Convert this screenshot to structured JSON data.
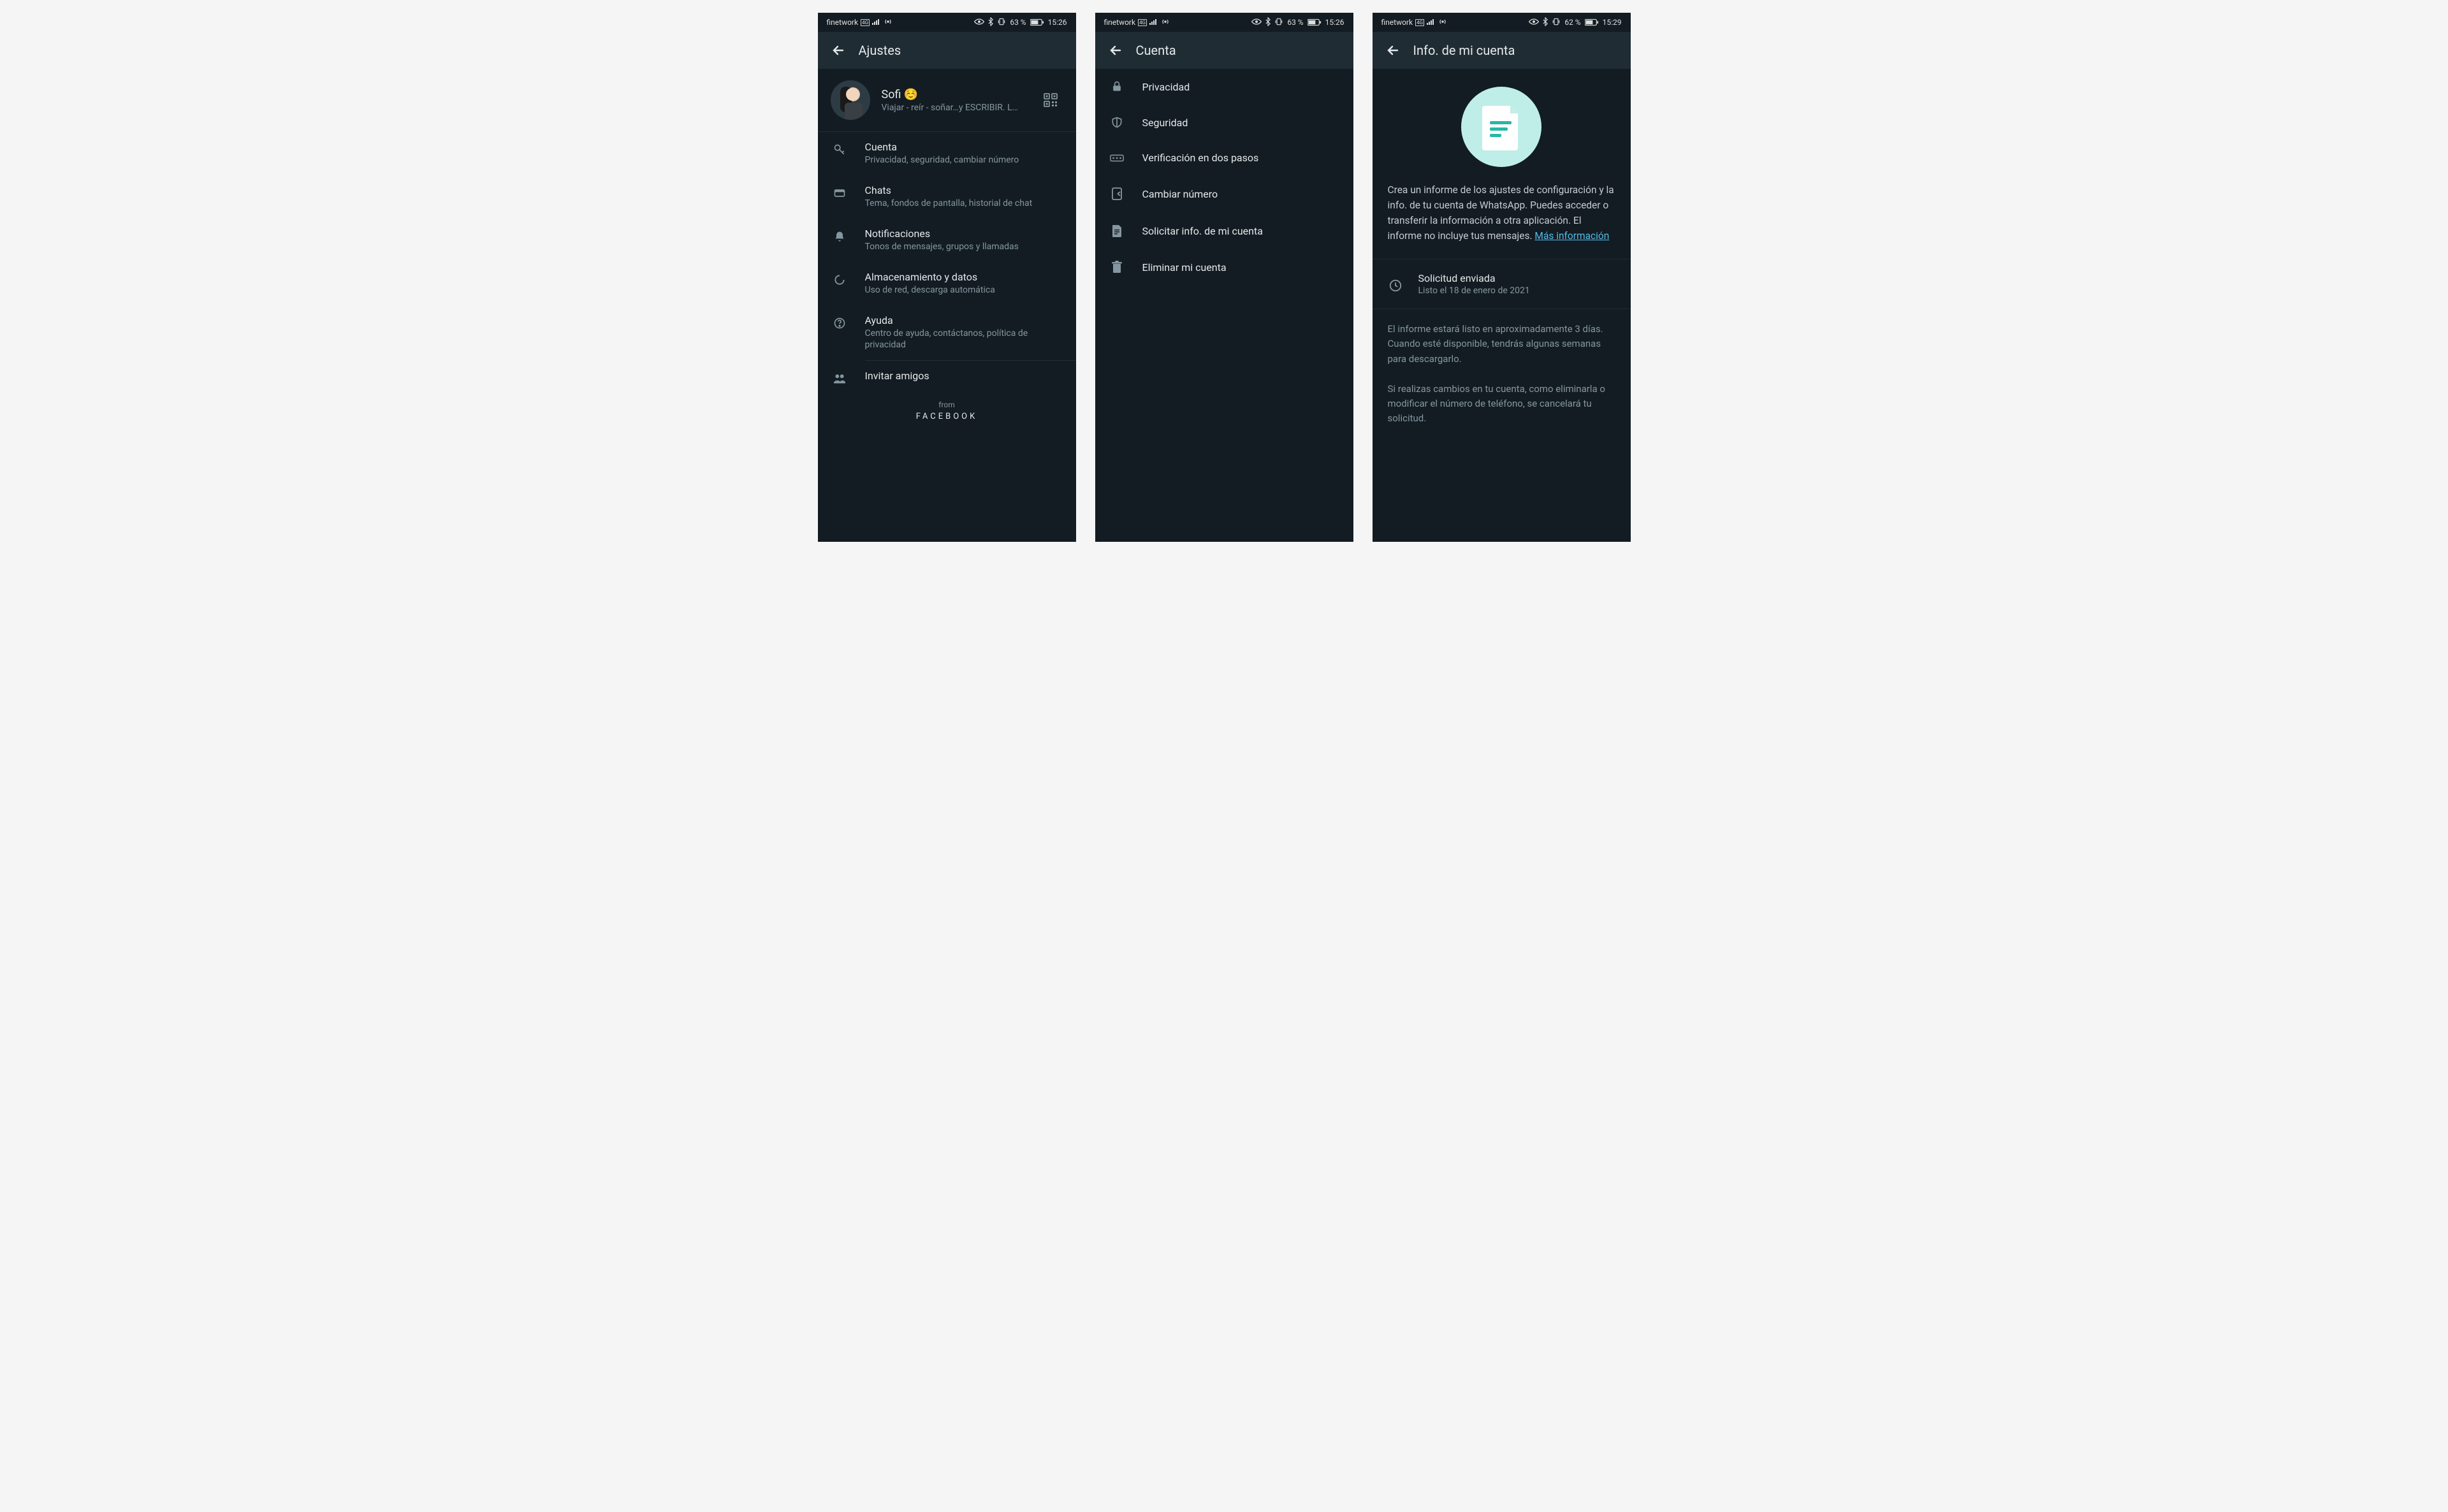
{
  "statusbar": {
    "carrier": "finetwork",
    "net_label": "4G",
    "battery1": "63 %",
    "battery2": "63 %",
    "battery3": "62 %",
    "time1": "15:26",
    "time2": "15:26",
    "time3": "15:29"
  },
  "screen1": {
    "title": "Ajustes",
    "profile_name": "Sofi ☺️",
    "profile_status": "Viajar - reír - soñar…y ESCRIBIR. L…",
    "items": [
      {
        "title": "Cuenta",
        "sub": "Privacidad, seguridad, cambiar número"
      },
      {
        "title": "Chats",
        "sub": "Tema, fondos de pantalla, historial de chat"
      },
      {
        "title": "Notificaciones",
        "sub": "Tonos de mensajes, grupos y llamadas"
      },
      {
        "title": "Almacenamiento y datos",
        "sub": "Uso de red, descarga automática"
      },
      {
        "title": "Ayuda",
        "sub": "Centro de ayuda, contáctanos, política de privacidad"
      },
      {
        "title": "Invitar amigos",
        "sub": ""
      }
    ],
    "footer_from": "from",
    "footer_fb": "FACEBOOK"
  },
  "screen2": {
    "title": "Cuenta",
    "items": [
      "Privacidad",
      "Seguridad",
      "Verificación en dos pasos",
      "Cambiar número",
      "Solicitar info. de mi cuenta",
      "Eliminar mi cuenta"
    ]
  },
  "screen3": {
    "title": "Info. de mi cuenta",
    "intro": "Crea un informe de los ajustes de configuración y la info. de tu cuenta de WhatsApp. Puedes acceder o transferir la información a otra aplicación. El informe no incluye tus mensajes.",
    "more_info": "Más información",
    "request_title": "Solicitud enviada",
    "request_sub": "Listo el 18 de enero de 2021",
    "para1": "El informe estará listo en aproximadamente 3 días. Cuando esté disponible, tendrás algunas semanas para descargarlo.",
    "para2": "Si realizas cambios en tu cuenta, como eliminarla o modificar el número de teléfono, se cancelará tu solicitud."
  }
}
